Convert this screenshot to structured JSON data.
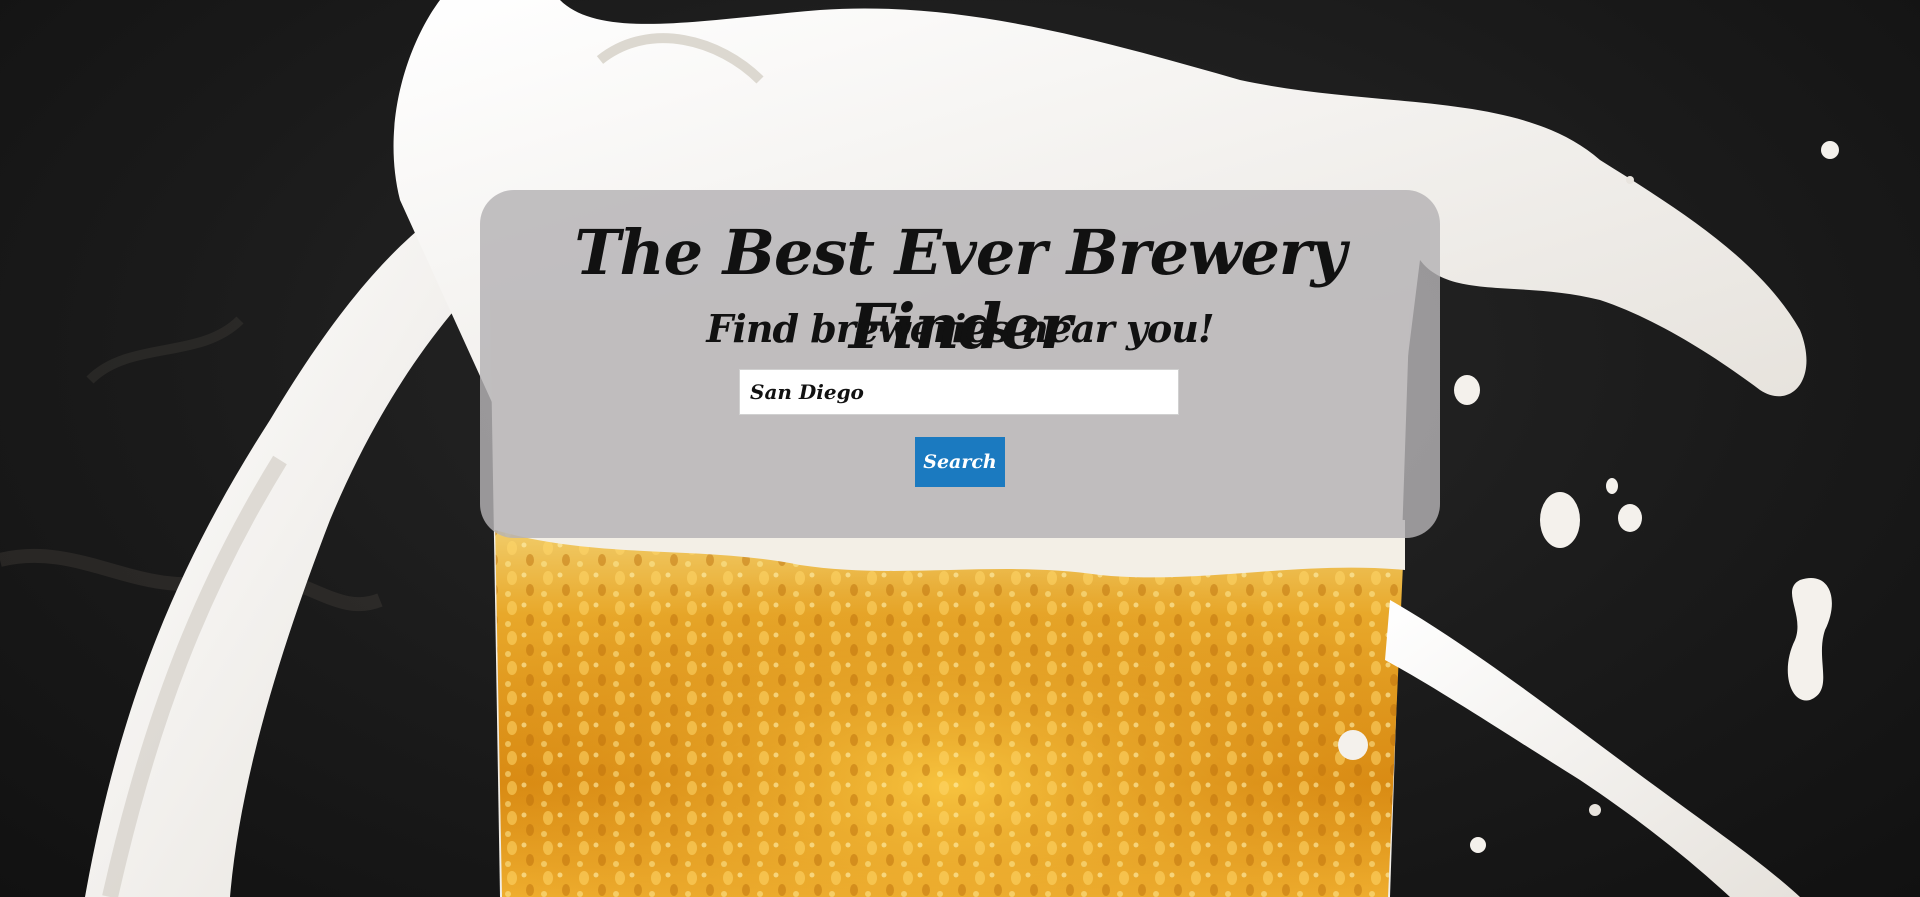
{
  "page": {
    "title": "The Best Ever Brewery Finder",
    "subtitle": "Find breweries near you!"
  },
  "search": {
    "value": "San Diego",
    "placeholder": "",
    "button_label": "Search"
  },
  "colors": {
    "background": "#1c1c1c",
    "card": "#b4b2b4",
    "button": "#1b7ac0",
    "beer": "#e0a024",
    "foam": "#f2f0ec"
  },
  "background_image": "beer-splash-image"
}
